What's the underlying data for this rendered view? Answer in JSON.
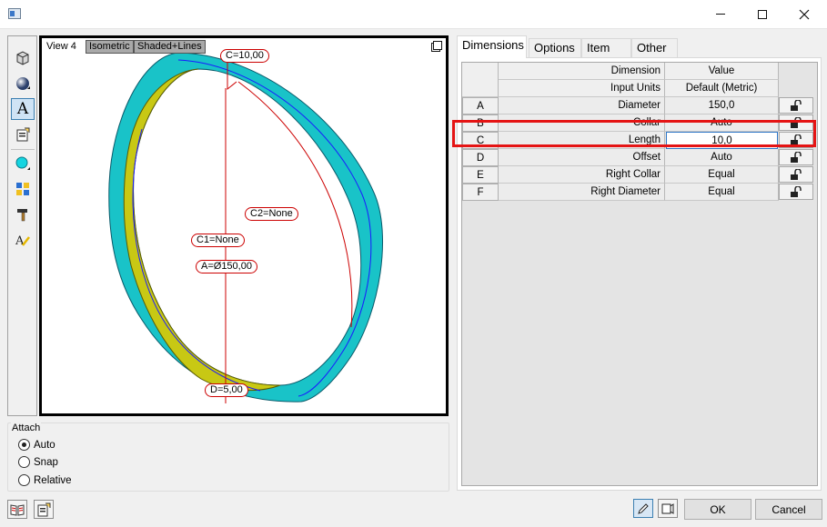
{
  "window": {
    "title": "",
    "controls": [
      "minimize",
      "maximize",
      "close"
    ]
  },
  "toolbar": {
    "tools": [
      {
        "name": "view-cube-icon"
      },
      {
        "name": "shading-sphere-icon"
      },
      {
        "name": "text-annotation-icon",
        "label": "A",
        "selected": true
      },
      {
        "name": "properties-icon"
      },
      {
        "name": "circle-shape-icon"
      },
      {
        "name": "layout-grid-icon"
      },
      {
        "name": "hammer-tool-icon"
      },
      {
        "name": "text-style-icon"
      }
    ]
  },
  "viewport": {
    "view_name": "View 4",
    "projection": "Isometric",
    "display_mode": "Shaded+Lines",
    "dimension_labels": {
      "c": "C=10,00",
      "c2": "C2=None",
      "c1": "C1=None",
      "a": "A=Ø150,00",
      "d": "D=5,00"
    }
  },
  "attach": {
    "title": "Attach",
    "options": [
      "Auto",
      "Snap",
      "Relative"
    ],
    "selected": "Auto"
  },
  "tabs": [
    "Dimensions",
    "Options",
    "Item",
    "Other"
  ],
  "active_tab": "Dimensions",
  "grid": {
    "header": {
      "dimension": "Dimension",
      "value": "Value"
    },
    "units_row": {
      "name": "Input Units",
      "value": "Default (Metric)"
    },
    "rows": [
      {
        "key": "A",
        "name": "Diameter",
        "value": "150,0"
      },
      {
        "key": "B",
        "name": "Collar",
        "value": "Auto"
      },
      {
        "key": "C",
        "name": "Length",
        "value": "10,0"
      },
      {
        "key": "D",
        "name": "Offset",
        "value": "Auto"
      },
      {
        "key": "E",
        "name": "Right Collar",
        "value": "Equal"
      },
      {
        "key": "F",
        "name": "Right Diameter",
        "value": "Equal"
      }
    ],
    "editing_row": "C"
  },
  "buttons": {
    "ok": "OK",
    "cancel": "Cancel"
  },
  "colors": {
    "ring_face": "#19c3c8",
    "ring_inner": "#c8c814",
    "dimension_red": "#cc0000",
    "highlight_red": "#e51414"
  }
}
